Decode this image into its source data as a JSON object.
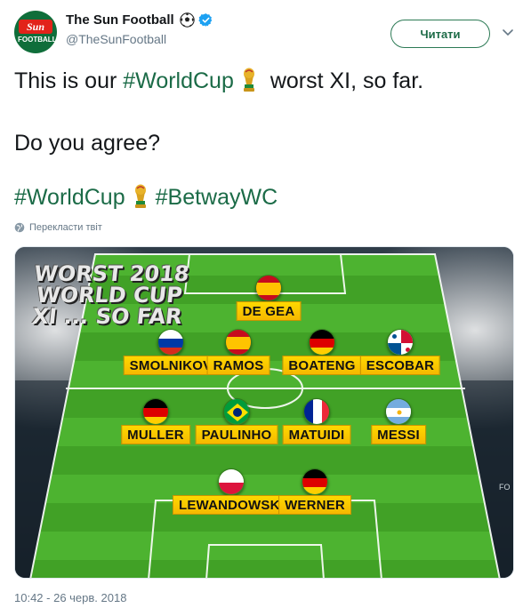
{
  "account": {
    "display_name": "The Sun Football",
    "handle": "@TheSunFootball",
    "avatar_top": "Sun",
    "avatar_bottom": "FOOTBALL"
  },
  "follow_button": "Читати",
  "tweet": {
    "line1_prefix": "This is our ",
    "line1_hashtag": "#WorldCup",
    "line1_suffix": " worst XI, so far.",
    "line2": "Do you agree?",
    "line3_hashtag1": "#WorldCup",
    "line3_hashtag2": "#BetwayWC"
  },
  "translate_label": "Перекласти твіт",
  "timestamp": "10:42 - 26 черв. 2018",
  "image": {
    "title": "WORST 2018 WORLD CUP XI ... SO FAR",
    "players": [
      {
        "name": "DE GEA",
        "flag": "spain"
      },
      {
        "name": "SMOLNIKOV",
        "flag": "russia"
      },
      {
        "name": "RAMOS",
        "flag": "spain"
      },
      {
        "name": "BOATENG",
        "flag": "germany"
      },
      {
        "name": "ESCOBAR",
        "flag": "panama"
      },
      {
        "name": "MULLER",
        "flag": "germany"
      },
      {
        "name": "PAULINHO",
        "flag": "brazil"
      },
      {
        "name": "MATUIDI",
        "flag": "france"
      },
      {
        "name": "MESSI",
        "flag": "argentina"
      },
      {
        "name": "LEWANDOWSKI",
        "flag": "poland"
      },
      {
        "name": "WERNER",
        "flag": "germany"
      }
    ],
    "corner_text": "FO"
  },
  "colors": {
    "hashtag": "#1b6b47",
    "pitch_light": "#4caf2e",
    "pitch_dark": "#3f9a25",
    "tag": "#ffd800"
  }
}
